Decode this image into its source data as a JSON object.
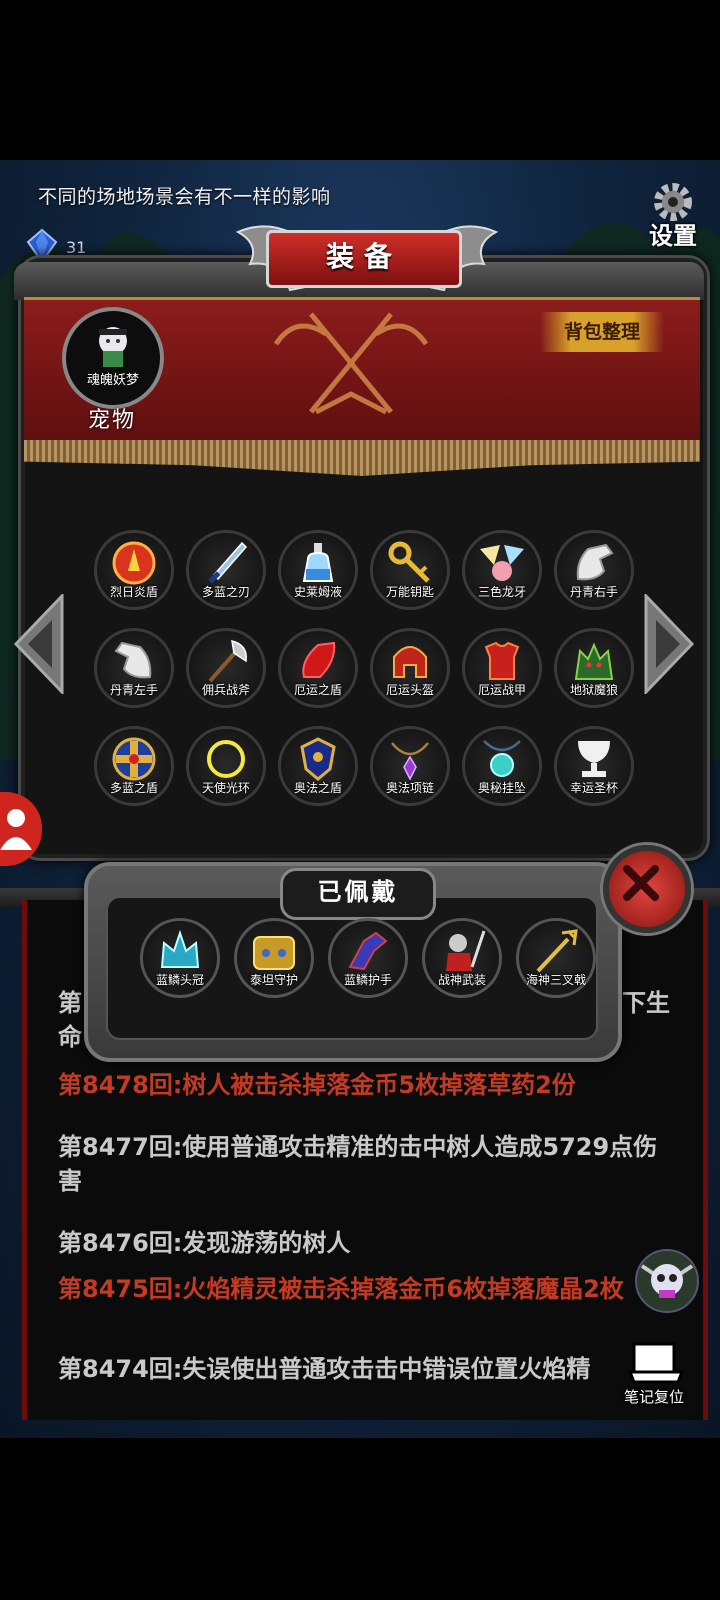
{
  "tip": "不同的场地场景会有不一样的影响",
  "gem_count": "31",
  "settings_label": "设置",
  "panel_title": "装备",
  "bag_sort_label": "背包整理",
  "pet": {
    "name": "魂魄妖梦",
    "label": "宠物"
  },
  "items": [
    {
      "label": "烈日炎盾",
      "icon": "red-sun-shield-icon"
    },
    {
      "label": "多蓝之刃",
      "icon": "blue-blade-icon"
    },
    {
      "label": "史莱姆液",
      "icon": "slime-potion-icon"
    },
    {
      "label": "万能钥匙",
      "icon": "golden-key-icon"
    },
    {
      "label": "三色龙牙",
      "icon": "tricolor-fang-icon"
    },
    {
      "label": "丹青右手",
      "icon": "white-glove-right-icon"
    },
    {
      "label": "丹青左手",
      "icon": "white-glove-left-icon"
    },
    {
      "label": "佣兵战斧",
      "icon": "battle-axe-icon"
    },
    {
      "label": "厄运之盾",
      "icon": "red-shield-icon"
    },
    {
      "label": "厄运头盔",
      "icon": "red-helmet-icon"
    },
    {
      "label": "厄运战甲",
      "icon": "red-armor-icon"
    },
    {
      "label": "地狱魔狼",
      "icon": "hell-wolf-icon"
    },
    {
      "label": "多蓝之盾",
      "icon": "blue-round-shield-icon"
    },
    {
      "label": "天使光环",
      "icon": "angel-halo-icon"
    },
    {
      "label": "奥法之盾",
      "icon": "arcane-shield-icon"
    },
    {
      "label": "奥法项链",
      "icon": "arcane-necklace-icon"
    },
    {
      "label": "奥秘挂坠",
      "icon": "mystic-pendant-icon"
    },
    {
      "label": "幸运圣杯",
      "icon": "lucky-grail-icon"
    }
  ],
  "worn_title": "已佩戴",
  "worn_items": [
    {
      "label": "蓝鳞头冠",
      "icon": "blue-crown-icon"
    },
    {
      "label": "泰坦守护",
      "icon": "titan-armor-icon"
    },
    {
      "label": "蓝鳞护手",
      "icon": "blue-gauntlet-icon"
    },
    {
      "label": "战神武装",
      "icon": "war-god-icon"
    },
    {
      "label": "海神三叉戟",
      "icon": "trident-icon"
    }
  ],
  "log_partial": {
    "first": "第",
    "second": "命",
    "right": "下生"
  },
  "log": [
    {
      "text": "第8478回:树人被击杀掉落金币5枚掉落草药2份",
      "color": "red"
    },
    {
      "text": "第8477回:使用普通攻击精准的击中树人造成5729点伤害",
      "color": "gray"
    },
    {
      "text": "第8476回:发现游荡的树人",
      "color": "gray"
    },
    {
      "text": "第8475回:火焰精灵被击杀掉落金币6枚掉落魔晶2枚",
      "color": "red"
    },
    {
      "text": "第8474回:失误使出普通攻击击中错误位置火焰精",
      "color": "gray"
    }
  ],
  "reset_label": "笔记复位"
}
